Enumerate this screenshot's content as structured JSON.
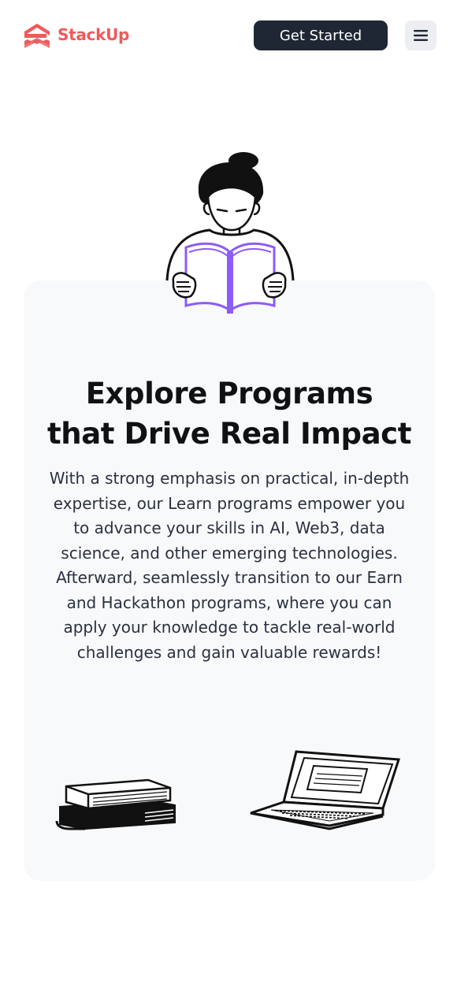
{
  "header": {
    "brand_name": "StackUp",
    "brand_color": "#ef5a5a",
    "logo_icon": "stackup-logo-icon",
    "cta_label": "Get Started",
    "menu_icon": "hamburger-menu-icon"
  },
  "hero": {
    "illustration": "person-reading-book-illustration",
    "title_line1": "Explore Programs",
    "title_line2": "that Drive Real Impact",
    "description": "With a strong emphasis on practical, in-depth expertise, our Learn programs empower you to advance your skills in AI, Web3, data science, and other emerging technologies. Afterward, seamlessly transition to our Earn and Hackathon programs, where you can apply your knowledge to tackle real-world challenges and gain valuable rewards!",
    "accent_color": "#8b5cf6",
    "card_background": "#f8f9fb",
    "bottom_illustrations": [
      "stack-of-books-illustration",
      "laptop-illustration"
    ]
  }
}
